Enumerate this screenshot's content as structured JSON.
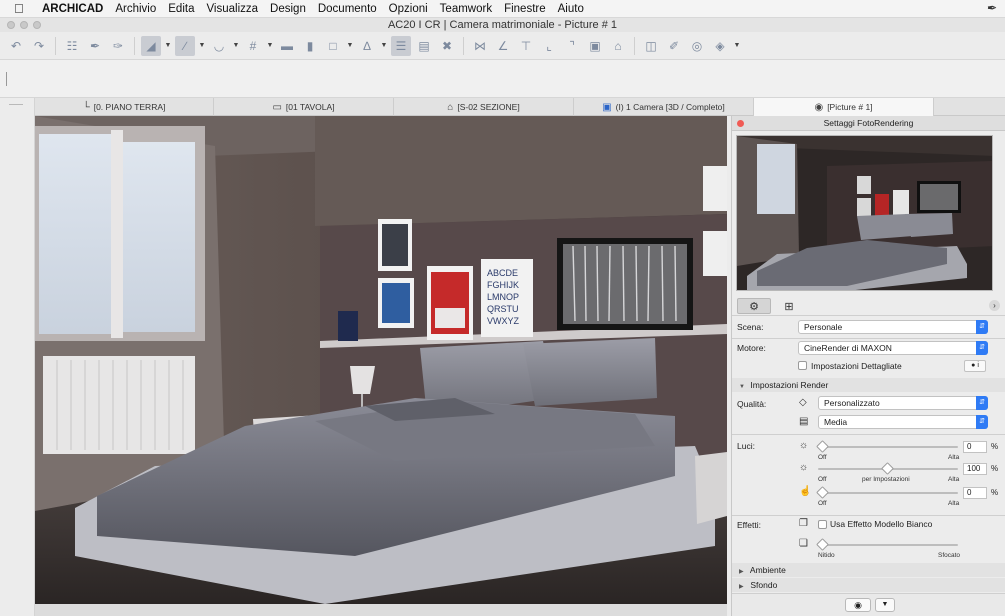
{
  "menubar": {
    "app": "ARCHICAD",
    "items": [
      "Archivio",
      "Edita",
      "Visualizza",
      "Design",
      "Documento",
      "Opzioni",
      "Teamwork",
      "Finestre",
      "Aiuto"
    ]
  },
  "window": {
    "title": "AC20 I CR | Camera matrimoniale - Picture # 1"
  },
  "tabs": [
    {
      "label": "[0. PIANO TERRA]",
      "icon": "floorplan-icon"
    },
    {
      "label": "[01 TAVOLA]",
      "icon": "layout-icon"
    },
    {
      "label": "[S-02 SEZIONE]",
      "icon": "section-icon"
    },
    {
      "label": "(I) 1 Camera [3D / Completo]",
      "icon": "3d-camera-icon"
    },
    {
      "label": "[Picture # 1]",
      "icon": "picture-camera-icon"
    }
  ],
  "panel": {
    "title": "Settaggi FotoRendering",
    "scena": {
      "label": "Scena:",
      "value": "Personale"
    },
    "motore": {
      "label": "Motore:",
      "value": "CineRender di MAXON"
    },
    "dettagliate": {
      "label": "Impostazioni Dettagliate",
      "checked": false,
      "info_label": "i"
    },
    "render_section": "Impostazioni Render",
    "qualita": {
      "label": "Qualità:",
      "value1": "Personalizzato",
      "value2": "Media"
    },
    "luci": {
      "label": "Luci:",
      "sliders": [
        {
          "value": "0",
          "unit": "%",
          "left": "Off",
          "mid": "",
          "right": "Alta",
          "fraction": 0.0
        },
        {
          "value": "100",
          "unit": "%",
          "left": "Off",
          "mid": "per Impostazioni",
          "right": "Alta",
          "fraction": 0.5
        },
        {
          "value": "0",
          "unit": "%",
          "left": "Off",
          "mid": "",
          "right": "Alta",
          "fraction": 0.0
        }
      ]
    },
    "effetti": {
      "label": "Effetti:",
      "bianco": {
        "label": "Usa Effetto Modello Bianco",
        "checked": false
      },
      "dof": {
        "left": "Nitido",
        "right": "Sfocato",
        "fraction": 0.0
      }
    },
    "ambiente": "Ambiente",
    "sfondo": "Sfondo"
  },
  "colors": {
    "accent": "#2f7bf5",
    "close": "#f05b55"
  }
}
